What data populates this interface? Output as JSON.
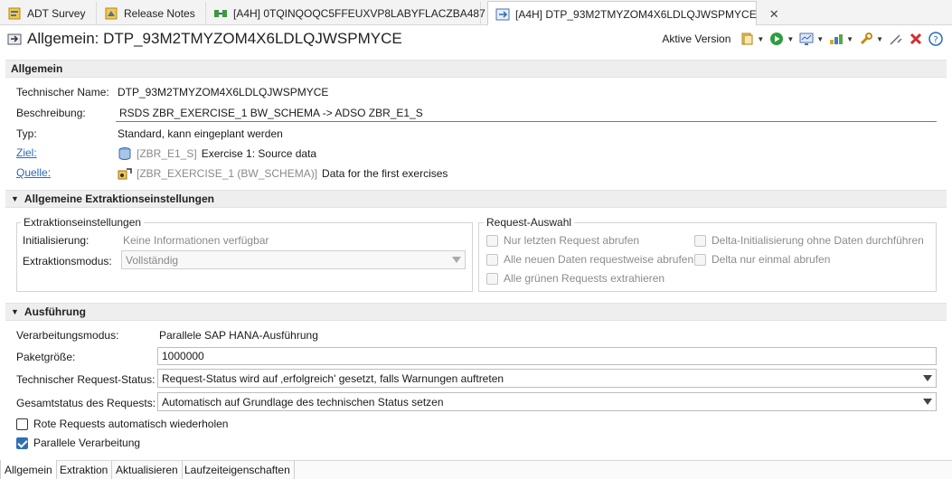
{
  "tabs": [
    {
      "label": "ADT Survey",
      "icon": "survey-icon"
    },
    {
      "label": "Release Notes",
      "icon": "release-notes-icon"
    },
    {
      "label": "[A4H] 0TQINQOQC5FFEUXVP8LABYFLACZBA487",
      "icon": "transformation-icon"
    },
    {
      "label": "[A4H] DTP_93M2TMYZOM4X6LDLQJWSPMYCE",
      "icon": "dtp-icon",
      "active": true,
      "close": "✕"
    }
  ],
  "editor": {
    "title": "Allgemein: DTP_93M2TMYZOM4X6LDLQJWSPMYCE",
    "version_label": "Aktive Version"
  },
  "general": {
    "header": "Allgemein",
    "tech_name_label": "Technischer Name:",
    "tech_name_value": "DTP_93M2TMYZOM4X6LDLQJWSPMYCE",
    "desc_label": "Beschreibung:",
    "desc_value": "RSDS ZBR_EXERCISE_1 BW_SCHEMA -> ADSO ZBR_E1_S",
    "type_label": "Typ:",
    "type_value": "Standard, kann eingeplant werden",
    "target_label": "Ziel:",
    "target_tech": "[ZBR_E1_S]",
    "target_desc": "Exercise 1: Source data",
    "source_label": "Quelle:",
    "source_tech": "[ZBR_EXERCISE_1 (BW_SCHEMA)]",
    "source_desc": "Data for the first exercises"
  },
  "extraction": {
    "header": "Allgemeine Extraktionseinstellungen",
    "settings_title": "Extraktionseinstellungen",
    "init_label": "Initialisierung:",
    "init_value": "Keine Informationen verfügbar",
    "mode_label": "Extraktionsmodus:",
    "mode_value": "Vollständig",
    "request_title": "Request-Auswahl",
    "options": [
      "Nur letzten Request abrufen",
      "Delta-Initialisierung ohne Daten durchführen",
      "Alle neuen Daten requestweise abrufen",
      "Delta nur einmal abrufen",
      "Alle grünen Requests extrahieren"
    ]
  },
  "execution": {
    "header": "Ausführung",
    "proc_mode_label": "Verarbeitungsmodus:",
    "proc_mode_value": "Parallele SAP HANA-Ausführung",
    "package_label": "Paketgröße:",
    "package_value": "1000000",
    "tech_status_label": "Technischer Request-Status:",
    "tech_status_value": "Request-Status wird auf ‚erfolgreich' gesetzt, falls Warnungen auftreten",
    "overall_label": "Gesamtstatus des Requests:",
    "overall_value": "Automatisch auf Grundlage des technischen Status setzen",
    "retry_label": "Rote Requests automatisch wiederholen",
    "retry_checked": false,
    "parallel_label": "Parallele Verarbeitung",
    "parallel_checked": true
  },
  "bottom_tabs": [
    "Allgemein",
    "Extraktion",
    "Aktualisieren",
    "Laufzeiteigenschaften"
  ],
  "colors": {
    "link": "#2a6ab8",
    "accent": "#2f6fb5",
    "delete": "#d32f2f",
    "run": "#2e9d3e"
  }
}
